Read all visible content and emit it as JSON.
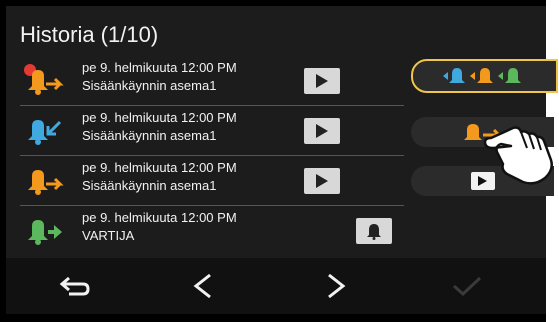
{
  "header": {
    "title": "Historia (1/10)"
  },
  "rows": [
    {
      "line1": "pe 9. helmikuuta 12:00 PM",
      "line2": "Sisäänkäynnin asema1",
      "icon": "incoming-call-bell-orange-unread",
      "action": "play-button"
    },
    {
      "line1": "pe 9. helmikuuta 12:00 PM",
      "line2": "Sisäänkäynnin asema1",
      "icon": "missed-call-bell-blue",
      "action": "play-button"
    },
    {
      "line1": "pe 9. helmikuuta 12:00 PM",
      "line2": "Sisäänkäynnin asema1",
      "icon": "incoming-call-bell-orange",
      "action": "play-button"
    },
    {
      "line1": "pe 9. helmikuuta 12:00 PM",
      "line2": "VARTIJA",
      "icon": "outgoing-call-bell-green",
      "action": "bell-button"
    }
  ],
  "side_filters": [
    {
      "name": "filter-all",
      "icons": [
        "bell-blue",
        "bell-orange",
        "bell-green"
      ],
      "selected": true
    },
    {
      "name": "filter-incoming",
      "icons": [
        "incoming-bell-orange"
      ],
      "selected": false
    },
    {
      "name": "filter-recorded",
      "icons": [
        "play-icon"
      ],
      "selected": false
    }
  ],
  "footer": {
    "buttons": [
      "back-icon",
      "previous-icon",
      "next-icon",
      "check-icon"
    ]
  },
  "colors": {
    "orange": "#f39a1e",
    "blue": "#3fa9e0",
    "green": "#5cb85c",
    "yellow_border": "#f0c64a",
    "red_dot": "#e53935"
  }
}
